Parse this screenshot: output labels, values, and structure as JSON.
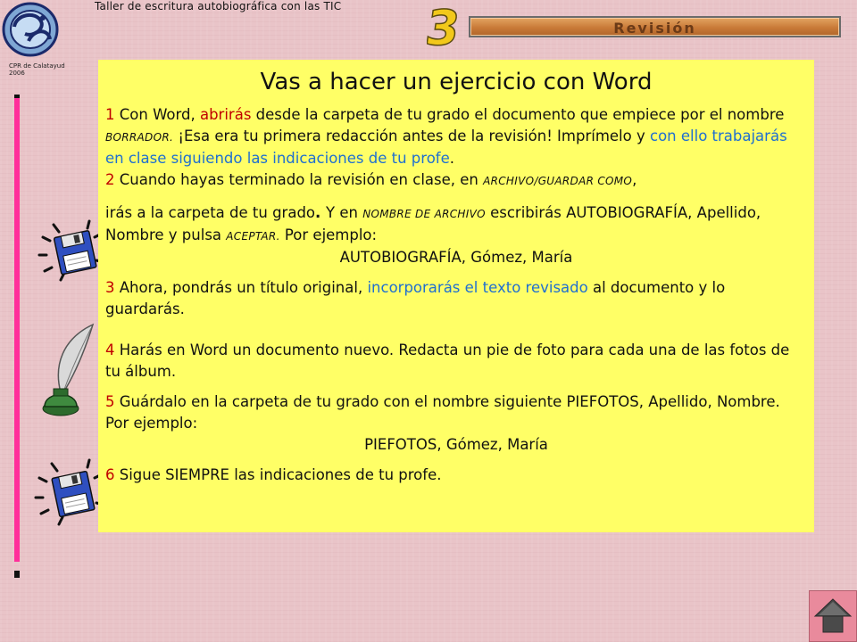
{
  "header": {
    "title": "Taller de escritura autobiográfica con las TIC",
    "logo_caption_line1": "CPR de Calatayud",
    "logo_caption_line2": "2006",
    "section_number": "3",
    "section_label": "Revisión"
  },
  "main": {
    "heading": "Vas a hacer un ejercicio con Word",
    "p1": {
      "num": "1 ",
      "t1": "Con Word, ",
      "t2": "abrirás",
      "t3": " desde la carpeta de tu grado el documento que empiece por el nombre ",
      "t4": "BORRADOR.",
      "t5": " ¡Esa era tu primera redacción antes de la revisión! Imprímelo y ",
      "t6": "con ello trabajarás en clase siguiendo las indicaciones de tu profe",
      "t7": "."
    },
    "p2": {
      "num": "2 ",
      "t1": "Cuando hayas terminado la revisión en clase, en ",
      "t2": "ARCHIVO/GUARDAR COMO",
      "t3": ",",
      "t4": "irás a la carpeta de tu grado",
      "t5": ". ",
      "t6": "Y en ",
      "t7": "NOMBRE DE ARCHIVO",
      "t8": " escribirás AUTOBIOGRAFÍA, Apellido, Nombre y pulsa ",
      "t9": "ACEPTAR.",
      "t10": " Por ejemplo:",
      "example": "AUTOBIOGRAFÍA, Gómez, María"
    },
    "p3": {
      "num": "3 ",
      "t1": "Ahora, pondrás un título original, ",
      "t2": "incorporarás el texto revisado",
      "t3": " al documento y lo guardarás."
    },
    "p4": {
      "num": "4 ",
      "t1": "Harás en Word un documento nuevo. Redacta un pie de foto para cada una de las fotos de tu álbum."
    },
    "p5": {
      "num": "5 ",
      "t1": "Guárdalo  en la carpeta de tu grado con el nombre siguiente PIEFOTOS, Apellido, Nombre. Por ejemplo:",
      "example": "PIEFOTOS, Gómez, María"
    },
    "p6": {
      "num": "6 ",
      "t1": "Sigue SIEMPRE las indicaciones de tu profe."
    }
  },
  "icons": {
    "floppy_top": "floppy-disk-icon",
    "quill": "quill-inkwell-icon",
    "floppy_bottom": "floppy-disk-icon",
    "home": "home-arrow-icon"
  },
  "colors": {
    "panel": "#ffff66",
    "highlight_red": "#c00000",
    "highlight_blue": "#1f6fd0",
    "left_bar": "#ff2f9a"
  }
}
